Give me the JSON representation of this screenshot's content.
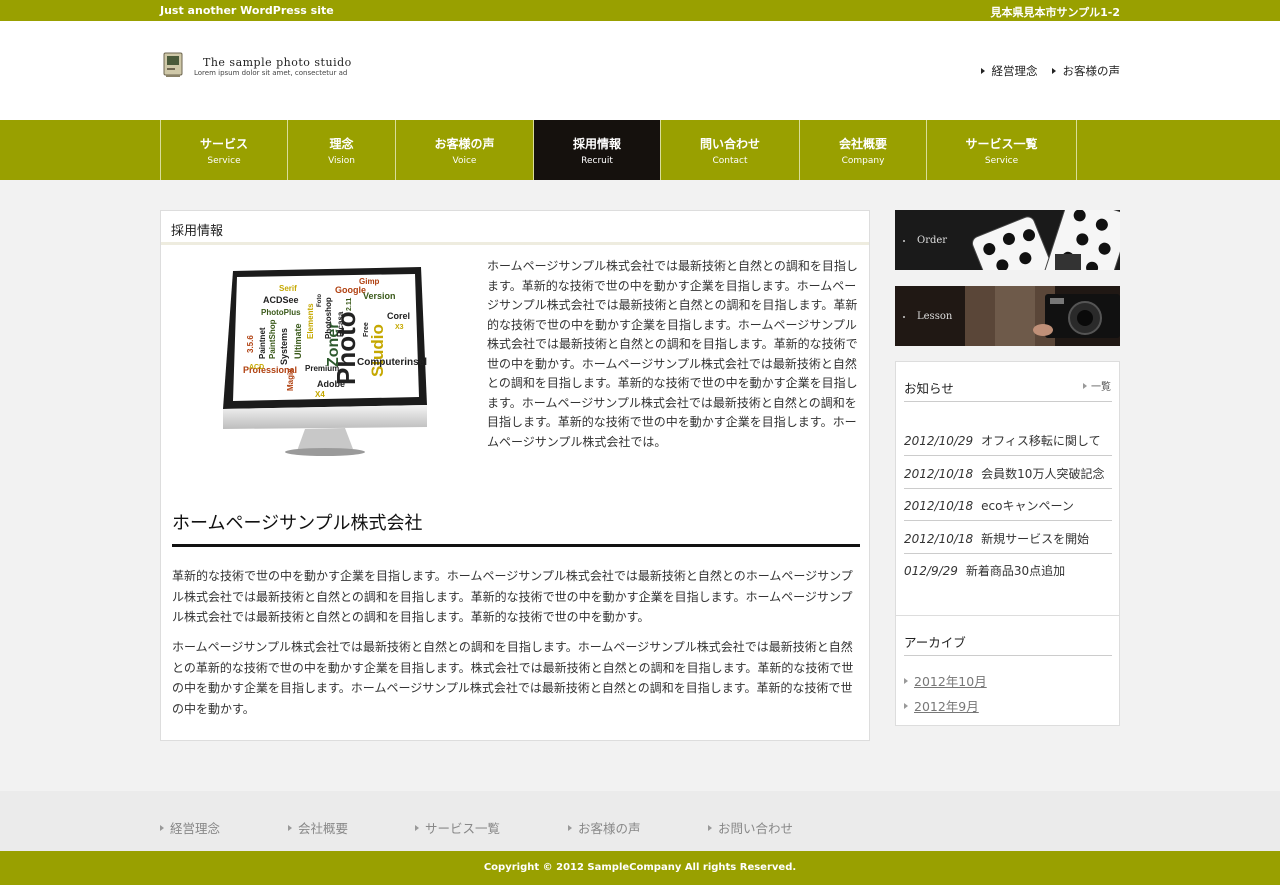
{
  "topbar": {
    "tagline": "Just another WordPress site",
    "address": "見本県見本市サンプル1-2"
  },
  "header": {
    "logo_icon": "vintage-computer-icon",
    "logo_title": "The sample photo stuido",
    "logo_sub": "Lorem ipsum dolor sit amet, consectetur ad",
    "links": [
      {
        "label": "経営理念"
      },
      {
        "label": "お客様の声"
      }
    ]
  },
  "nav": {
    "items": [
      {
        "jp": "サービス",
        "en": "Service",
        "active": false
      },
      {
        "jp": "理念",
        "en": "Vision",
        "active": false
      },
      {
        "jp": "お客様の声",
        "en": "Voice",
        "active": false
      },
      {
        "jp": "採用情報",
        "en": "Recruit",
        "active": true
      },
      {
        "jp": "問い合わせ",
        "en": "Contact",
        "active": false
      },
      {
        "jp": "会社概要",
        "en": "Company",
        "active": false
      },
      {
        "jp": "サービス一覧",
        "en": "Service",
        "active": false
      }
    ]
  },
  "main": {
    "title": "採用情報",
    "image": "monitor-word-cloud-image",
    "intro": "ホームページサンプル株式会社では最新技術と自然との調和を目指します。革新的な技術で世の中を動かす企業を目指します。ホームページサンプル株式会社では最新技術と自然との調和を目指します。革新的な技術で世の中を動かす企業を目指します。ホームページサンプル株式会社では最新技術と自然との調和を目指します。革新的な技術で世の中を動かす。ホームページサンプル株式会社では最新技術と自然との調和を目指します。革新的な技術で世の中を動かす企業を目指します。ホームページサンプル株式会社では最新技術と自然との調和を目指します。革新的な技術で世の中を動かす企業を目指します。ホームページサンプル株式会社では。",
    "heading": "ホームページサンプル株式会社",
    "para1": "革新的な技術で世の中を動かす企業を目指します。ホームページサンプル株式会社では最新技術と自然とのホームページサンプル株式会社では最新技術と自然との調和を目指します。革新的な技術で世の中を動かす企業を目指します。ホームページサンプル株式会社では最新技術と自然との調和を目指します。革新的な技術で世の中を動かす。",
    "para2": "ホームページサンプル株式会社では最新技術と自然との調和を目指します。ホームページサンプル株式会社では最新技術と自然との革新的な技術で世の中を動かす企業を目指します。株式会社では最新技術と自然との調和を目指します。革新的な技術で世の中を動かす企業を目指します。ホームページサンプル株式会社では最新技術と自然との調和を目指します。革新的な技術で世の中を動かす。"
  },
  "sidebar": {
    "banners": [
      {
        "label": "Order",
        "image": "polka-dot-phone-case-image"
      },
      {
        "label": "Lesson",
        "image": "camera-image"
      }
    ],
    "news": {
      "title": "お知らせ",
      "more": "一覧",
      "items": [
        {
          "date": "2012/10/29",
          "text": "オフィス移転に関して"
        },
        {
          "date": "2012/10/18",
          "text": "会員数10万人突破記念"
        },
        {
          "date": "2012/10/18",
          "text": "ecoキャンペーン"
        },
        {
          "date": "2012/10/18",
          "text": "新規サービスを開始"
        },
        {
          "date": "012/9/29",
          "text": "新着商品30点追加"
        }
      ]
    },
    "archive": {
      "title": "アーカイブ",
      "items": [
        {
          "label": "2012年10月"
        },
        {
          "label": "2012年9月"
        }
      ]
    }
  },
  "footer": {
    "links": [
      {
        "label": "経営理念"
      },
      {
        "label": "会社概要"
      },
      {
        "label": "サービス一覧"
      },
      {
        "label": "お客様の声"
      },
      {
        "label": "お問い合わせ"
      }
    ],
    "copyright": "Copyright © 2012 SampleCompany All rights Reserved."
  },
  "colors": {
    "brand": "#99a000",
    "nav_active": "#15110d"
  }
}
